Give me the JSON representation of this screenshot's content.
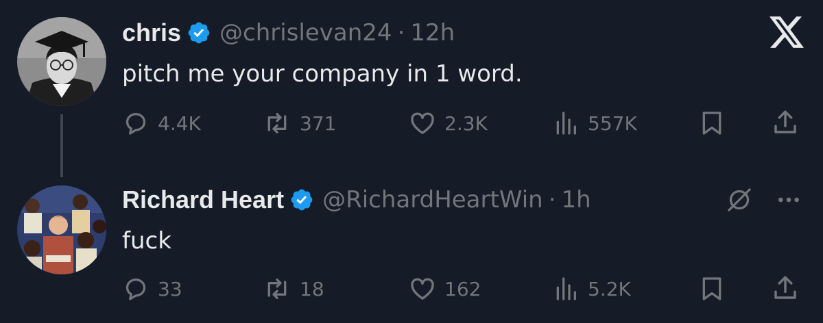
{
  "brand": {
    "logo_icon": "x-logo-icon",
    "verified_color": "#1d9bf0",
    "background": "#151c27"
  },
  "tweets": [
    {
      "name": "chris",
      "handle": "@chrislevan24",
      "separator": "·",
      "time": "12h",
      "text": "pitch me your company in 1 word.",
      "replies": "4.4K",
      "reposts": "371",
      "likes": "2.3K",
      "views": "557K"
    },
    {
      "name": "Richard Heart",
      "handle": "@RichardHeartWin",
      "separator": "·",
      "time": "1h",
      "text": "fuck",
      "replies": "33",
      "reposts": "18",
      "likes": "162",
      "views": "5.2K"
    }
  ]
}
